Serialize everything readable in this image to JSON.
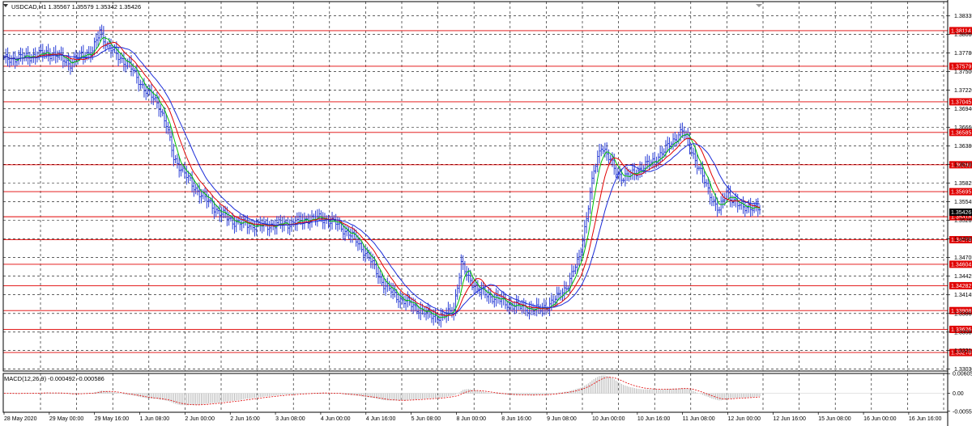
{
  "main_header": "USDCAD,H1  1.35567 1.35579 1.35342 1.35426",
  "indicator_header": "MACD(12,26,9) -0.000492 -0.000586",
  "current_price_label": "1.35426",
  "price_axis": {
    "ticks": [
      "1.38335",
      "1.38060",
      "1.37780",
      "1.37500",
      "1.37220",
      "1.36940",
      "1.36660",
      "1.36380",
      "1.36105",
      "1.35825",
      "1.35545",
      "1.35265",
      "1.34985",
      "1.34705",
      "1.34425",
      "1.34145",
      "1.33865",
      "1.33585",
      "1.33310",
      "1.33030"
    ],
    "min": 1.33,
    "max": 1.3855
  },
  "macd_axis": {
    "ticks": [
      "0.006051",
      "0.00",
      "-0.0055"
    ],
    "min": -0.0058,
    "max": 0.0061
  },
  "horizontal_levels": [
    "1.38114",
    "1.37579",
    "1.37045",
    "1.36585",
    "1.36099",
    "1.35695",
    "1.35318",
    "1.34973",
    "1.34604",
    "1.34282",
    "1.33908",
    "1.33626",
    "1.33278"
  ],
  "time_axis": [
    "28 May 2020",
    "29 May 00:00",
    "29 May 16:00",
    "1 Jun 08:00",
    "2 Jun 00:00",
    "2 Jun 16:00",
    "3 Jun 08:00",
    "4 Jun 00:00",
    "4 Jun 16:00",
    "5 Jun 08:00",
    "8 Jun 00:00",
    "8 Jun 16:00",
    "9 Jun 08:00",
    "10 Jun 00:00",
    "10 Jun 16:00",
    "11 Jun 08:00",
    "12 Jun 00:00",
    "12 Jun 16:00",
    "15 Jun 08:00",
    "16 Jun 00:00",
    "16 Jun 16:00"
  ],
  "colors": {
    "bars": "#2b3fd6",
    "level_line": "#e00000",
    "level_label_bg": "#e00000",
    "ma_fast": "#00c000",
    "ma_mid": "#e00000",
    "ma_slow": "#1a2bd8",
    "grid": "#000000",
    "macd_hist": "#b8b8b8",
    "macd_signal": "#e00000"
  },
  "chart_data": {
    "type": "candlestick",
    "symbol": "USDCAD",
    "timeframe": "H1",
    "close_path": [
      [
        0,
        1.3768
      ],
      [
        6,
        1.377
      ],
      [
        12,
        1.3772
      ],
      [
        18,
        1.3775
      ],
      [
        24,
        1.3778
      ],
      [
        30,
        1.3772
      ],
      [
        36,
        1.3762
      ],
      [
        42,
        1.3775
      ],
      [
        48,
        1.378
      ],
      [
        52,
        1.381
      ],
      [
        56,
        1.379
      ],
      [
        62,
        1.3772
      ],
      [
        68,
        1.376
      ],
      [
        72,
        1.374
      ],
      [
        76,
        1.3725
      ],
      [
        80,
        1.3712
      ],
      [
        84,
        1.37
      ],
      [
        88,
        1.367
      ],
      [
        92,
        1.362
      ],
      [
        96,
        1.3605
      ],
      [
        102,
        1.358
      ],
      [
        108,
        1.3562
      ],
      [
        116,
        1.354
      ],
      [
        124,
        1.3525
      ],
      [
        132,
        1.352
      ],
      [
        140,
        1.3518
      ],
      [
        148,
        1.352
      ],
      [
        156,
        1.3522
      ],
      [
        164,
        1.3528
      ],
      [
        172,
        1.353
      ],
      [
        180,
        1.3522
      ],
      [
        190,
        1.35
      ],
      [
        198,
        1.347
      ],
      [
        206,
        1.343
      ],
      [
        214,
        1.341
      ],
      [
        222,
        1.3398
      ],
      [
        230,
        1.3385
      ],
      [
        238,
        1.338
      ],
      [
        244,
        1.3395
      ],
      [
        248,
        1.346
      ],
      [
        252,
        1.344
      ],
      [
        258,
        1.342
      ],
      [
        266,
        1.341
      ],
      [
        274,
        1.34
      ],
      [
        282,
        1.3395
      ],
      [
        290,
        1.3392
      ],
      [
        296,
        1.34
      ],
      [
        300,
        1.341
      ],
      [
        306,
        1.343
      ],
      [
        312,
        1.347
      ],
      [
        316,
        1.353
      ],
      [
        320,
        1.36
      ],
      [
        324,
        1.364
      ],
      [
        328,
        1.362
      ],
      [
        332,
        1.36
      ],
      [
        336,
        1.359
      ],
      [
        340,
        1.3595
      ],
      [
        346,
        1.3605
      ],
      [
        352,
        1.3615
      ],
      [
        358,
        1.363
      ],
      [
        364,
        1.365
      ],
      [
        368,
        1.366
      ],
      [
        372,
        1.364
      ],
      [
        376,
        1.361
      ],
      [
        380,
        1.3585
      ],
      [
        384,
        1.356
      ],
      [
        388,
        1.354
      ],
      [
        392,
        1.357
      ],
      [
        396,
        1.3555
      ],
      [
        400,
        1.3545
      ],
      [
        404,
        1.3548
      ],
      [
        410,
        1.3542
      ]
    ]
  }
}
